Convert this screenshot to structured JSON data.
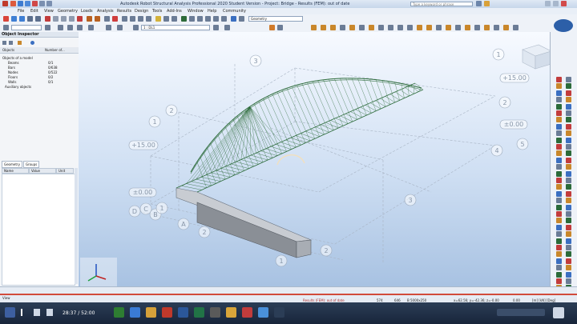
{
  "window": {
    "title": "Autodesk Robot Structural Analysis Professional 2020 Student Version - Project: Bridge - Results (FEM): out of date",
    "search_placeholder": "Type a keyword or phrase"
  },
  "menu": [
    "File",
    "Edit",
    "View",
    "Geometry",
    "Loads",
    "Analysis",
    "Results",
    "Design",
    "Tools",
    "Add-Ins",
    "Window",
    "Help",
    "Community"
  ],
  "toolbar": {
    "case_combo": "1 : DL1",
    "layout_combo": "Geometry"
  },
  "object_inspector": {
    "title": "Object Inspector",
    "col_objects": "Objects",
    "col_number": "Number of...",
    "tree": [
      {
        "label": "Objects of a model",
        "value": ""
      },
      {
        "label": "Beams",
        "value": "0/1"
      },
      {
        "label": "Bars",
        "value": "0/638"
      },
      {
        "label": "Nodes",
        "value": "0/522"
      },
      {
        "label": "Floors",
        "value": "0/2"
      },
      {
        "label": "Walls",
        "value": "0/1"
      },
      {
        "label": "Auxiliary objects",
        "value": ""
      }
    ],
    "tabs": [
      "Geometry",
      "Groups"
    ],
    "grid_headers": [
      "Name",
      "Value",
      "Unit"
    ]
  },
  "viewport": {
    "axis_labels": [
      "3",
      "2",
      "1",
      "1",
      "2",
      "4",
      "5",
      "D",
      "C",
      "B",
      "A",
      "2",
      "1",
      "2",
      "3",
      "1"
    ],
    "levels": [
      "+15.00",
      "±0.00",
      "+15.00",
      "±0.00"
    ],
    "view_tab": "3D",
    "level_combo": "Z = 0.00 m - Base"
  },
  "status": {
    "results": "Results (FEM): out of date",
    "count_a": "574",
    "count_b": "646",
    "section": "B 5000x250",
    "coords": "x=62.56; y=-42.36; z=-0.00",
    "angle": "0.00",
    "units": "[m] [kN] [Deg]",
    "view_label": "View"
  },
  "taskbar": {
    "time": "28:37 / 52:00"
  },
  "colors": {
    "accent": "#1f4f9a",
    "structure": "#2c6b3a",
    "grid_line": "#a8b4c4"
  }
}
